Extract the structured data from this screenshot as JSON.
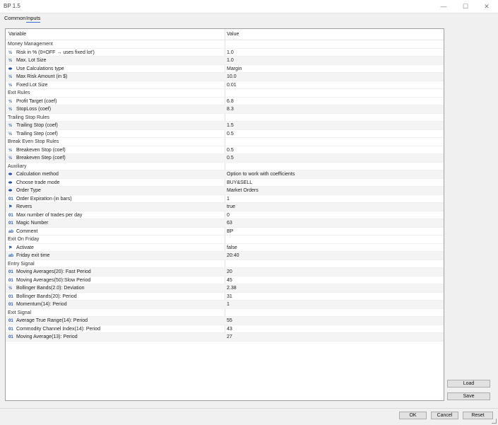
{
  "window": {
    "title": "BP 1.5",
    "min": "—",
    "max": "☐",
    "close": "✕"
  },
  "tabs": [
    {
      "label": "Common"
    },
    {
      "label": "Inputs"
    }
  ],
  "grid": {
    "col_variable": "Variable",
    "col_value": "Value"
  },
  "rows": [
    {
      "type": "section",
      "label": "Money Management"
    },
    {
      "type": "param",
      "icon": "½",
      "icon_name": "fraction-icon",
      "label": "Risk in % (0=OFF → uses fixed lot')",
      "value": "1.0"
    },
    {
      "type": "param",
      "icon": "½",
      "icon_name": "fraction-icon",
      "label": "Max. Lot Size",
      "value": "1.0"
    },
    {
      "type": "param",
      "icon": "⬬",
      "icon_name": "enum-icon",
      "label": "Use Calculations type",
      "value": "Margin"
    },
    {
      "type": "param",
      "icon": "½",
      "icon_name": "fraction-icon",
      "label": "Max Risk Amount (in $)",
      "value": "10.0"
    },
    {
      "type": "param",
      "icon": "½",
      "icon_name": "fraction-icon",
      "label": "Fixed Lot Size",
      "value": "0.01"
    },
    {
      "type": "section",
      "label": "Exit Rules"
    },
    {
      "type": "param",
      "icon": "½",
      "icon_name": "fraction-icon",
      "label": "Profit Target (coef)",
      "value": "6.8"
    },
    {
      "type": "param",
      "icon": "½",
      "icon_name": "fraction-icon",
      "label": "StopLoss (coef)",
      "value": "8.3"
    },
    {
      "type": "section",
      "label": "Trailing Stop Rules"
    },
    {
      "type": "param",
      "icon": "½",
      "icon_name": "fraction-icon",
      "label": "Trailing Stop (coef)",
      "value": "1.5"
    },
    {
      "type": "param",
      "icon": "½",
      "icon_name": "fraction-icon",
      "label": "Trailing Step (coef)",
      "value": "0.5"
    },
    {
      "type": "section",
      "label": "Break Even Stop Rules"
    },
    {
      "type": "param",
      "icon": "½",
      "icon_name": "fraction-icon",
      "label": "Breakeven Stop (coef)",
      "value": "0.5"
    },
    {
      "type": "param",
      "icon": "½",
      "icon_name": "fraction-icon",
      "label": "Breakeven Step (coef)",
      "value": "0.5"
    },
    {
      "type": "section",
      "label": "Auxiliary"
    },
    {
      "type": "param",
      "icon": "⬬",
      "icon_name": "enum-icon",
      "label": "Calculation method",
      "value": "Option to work with coefficients"
    },
    {
      "type": "param",
      "icon": "⬬",
      "icon_name": "enum-icon",
      "label": "Choose trade mode",
      "value": "BUY&SELL"
    },
    {
      "type": "param",
      "icon": "⬬",
      "icon_name": "enum-icon",
      "label": "Order Type",
      "value": "Market Orders"
    },
    {
      "type": "param",
      "icon": "01",
      "icon_name": "integer-icon",
      "label": "Order Expiration (in bars)",
      "value": "1"
    },
    {
      "type": "param",
      "icon": "⚑",
      "icon_name": "bool-icon",
      "label": "Revers",
      "value": "true"
    },
    {
      "type": "param",
      "icon": "01",
      "icon_name": "integer-icon",
      "label": "Max number of trades per day",
      "value": "0"
    },
    {
      "type": "param",
      "icon": "01",
      "icon_name": "integer-icon",
      "label": "Magic Number",
      "value": "63"
    },
    {
      "type": "param",
      "icon": "ab",
      "icon_name": "string-icon",
      "label": "Comment",
      "value": "BP"
    },
    {
      "type": "section",
      "label": "Exit On Friday"
    },
    {
      "type": "param",
      "icon": "⚑",
      "icon_name": "bool-icon",
      "label": "Activate",
      "value": "false"
    },
    {
      "type": "param",
      "icon": "ab",
      "icon_name": "string-icon",
      "label": "Friday exit time",
      "value": "20:40"
    },
    {
      "type": "section",
      "label": "Entry Signal"
    },
    {
      "type": "param",
      "icon": "01",
      "icon_name": "integer-icon",
      "label": "Moving Averages(20): Fast Period",
      "value": "20"
    },
    {
      "type": "param",
      "icon": "01",
      "icon_name": "integer-icon",
      "label": "Moving Averages(50):Slow Period",
      "value": "45"
    },
    {
      "type": "param",
      "icon": "½",
      "icon_name": "fraction-icon",
      "label": "Bollinger Bands(2.0): Deviation",
      "value": "2.38"
    },
    {
      "type": "param",
      "icon": "01",
      "icon_name": "integer-icon",
      "label": "Bollinger Bands(20): Period",
      "value": "31"
    },
    {
      "type": "param",
      "icon": "01",
      "icon_name": "integer-icon",
      "label": "Momentum(14): Period",
      "value": "1"
    },
    {
      "type": "section",
      "label": "Exit Signal"
    },
    {
      "type": "param",
      "icon": "01",
      "icon_name": "integer-icon",
      "label": "Average True Range(14): Period",
      "value": "55"
    },
    {
      "type": "param",
      "icon": "01",
      "icon_name": "integer-icon",
      "label": "Commodity Channel Index(14): Period",
      "value": "43"
    },
    {
      "type": "param",
      "icon": "01",
      "icon_name": "integer-icon",
      "label": "Moving Average(13): Period",
      "value": "27"
    }
  ],
  "side_buttons": {
    "load": "Load",
    "save": "Save"
  },
  "bottom_buttons": {
    "ok": "OK",
    "cancel": "Cancel",
    "reset": "Reset"
  }
}
